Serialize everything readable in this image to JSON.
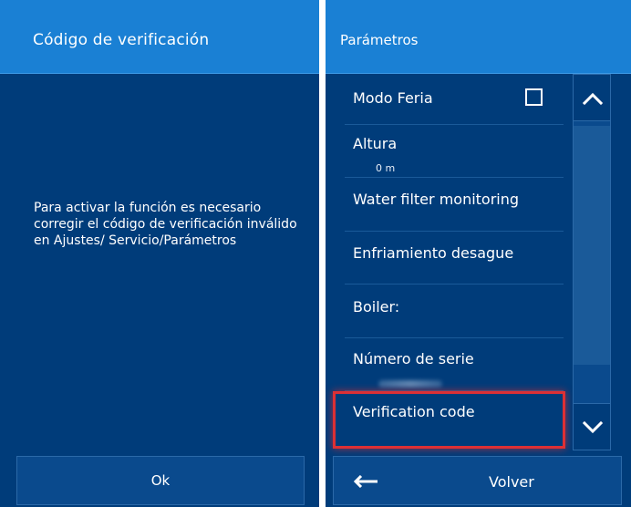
{
  "left_dialog": {
    "title": "Código de verificación",
    "message": "Para activar la función es necesario corregir el código de verificación inválido en Ajustes/ Servicio/Parámetros",
    "ok_label": "Ok"
  },
  "right_panel": {
    "title": "Parámetros",
    "items": [
      {
        "label": "Modo Feria",
        "checkbox": false
      },
      {
        "label": "Altura",
        "value": "0 m"
      },
      {
        "label": "Water filter monitoring"
      },
      {
        "label": "Enfriamiento desague"
      },
      {
        "label": "Boiler:"
      },
      {
        "label": "Número de serie"
      },
      {
        "label": "Verification code"
      }
    ],
    "back_label": "Volver"
  },
  "icons": {
    "scroll_up": "chevron-up-icon",
    "scroll_down": "chevron-down-icon",
    "back": "arrow-left-icon",
    "checkbox": "checkbox-unchecked-icon"
  },
  "colors": {
    "background": "#003c7a",
    "header": "#1a80d4",
    "button": "#0a4a8d",
    "highlight": "#dc3035"
  }
}
